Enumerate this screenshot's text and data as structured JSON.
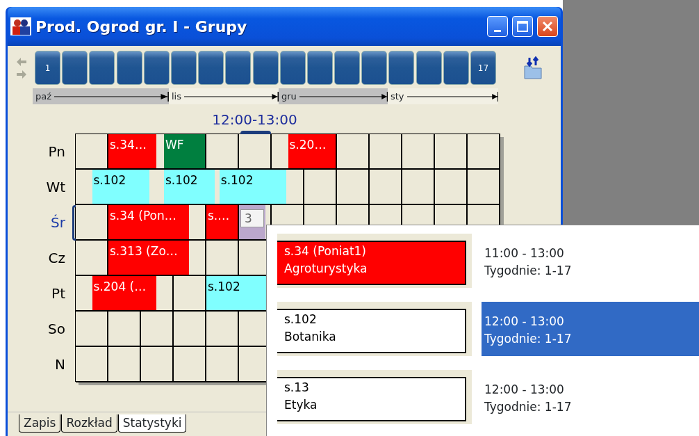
{
  "window": {
    "title": "Prod. Ogrod gr. I - Grupy"
  },
  "week_strip": {
    "first_label": "1",
    "last_label": "17"
  },
  "months": [
    {
      "label": "paź",
      "shaded": true
    },
    {
      "label": "lis",
      "shaded": false
    },
    {
      "label": "gru",
      "shaded": true
    },
    {
      "label": "sty",
      "shaded": false
    }
  ],
  "time_header": "12:00-13:00",
  "days": [
    {
      "label": "Pn",
      "selected": false,
      "events": [
        {
          "kind": "block",
          "text": "s.34…",
          "color": "#ff0000"
        },
        {
          "kind": "block",
          "text": "WF",
          "color": "#007f3f"
        },
        {
          "kind": "block",
          "text": "s.20…",
          "color": "#ff0000"
        }
      ]
    },
    {
      "label": "Wt",
      "selected": false,
      "events": [
        {
          "kind": "block",
          "text": "s.102",
          "color": "#80ffff"
        },
        {
          "kind": "block",
          "text": "s.102",
          "color": "#80ffff"
        },
        {
          "kind": "block",
          "text": "s.102",
          "color": "#80ffff"
        }
      ]
    },
    {
      "label": "Śr",
      "selected": true,
      "events": [
        {
          "kind": "block",
          "text": "s.34 (Pon…",
          "color": "#ff0000"
        },
        {
          "kind": "block",
          "text": "s.…",
          "color": "#ff0000"
        },
        {
          "kind": "spinner",
          "text": "3",
          "color": "#bba8cc"
        }
      ]
    },
    {
      "label": "Cz",
      "selected": false,
      "events": [
        {
          "kind": "block",
          "text": "s.313 (Zo…",
          "color": "#ff0000"
        }
      ]
    },
    {
      "label": "Pt",
      "selected": false,
      "events": [
        {
          "kind": "block",
          "text": "s.204 (…",
          "color": "#ff0000"
        },
        {
          "kind": "block",
          "text": "s.102",
          "color": "#80ffff"
        }
      ]
    },
    {
      "label": "So",
      "selected": false
    },
    {
      "label": "N",
      "selected": false
    }
  ],
  "popup": [
    {
      "room": "s.34 (Poniat1)",
      "subject": "Agroturystyka",
      "time": "11:00 - 13:00",
      "weeks": "Tygodnie: 1-17",
      "color": "#ff0000",
      "selected": false
    },
    {
      "room": "s.102",
      "subject": "Botanika",
      "time": "12:00 - 13:00",
      "weeks": "Tygodnie: 1-17",
      "color": "#ffffff",
      "selected": true
    },
    {
      "room": "s.13",
      "subject": "Etyka",
      "time": "12:00 - 13:00",
      "weeks": "Tygodnie: 1-17",
      "color": "#ffffff",
      "selected": false
    }
  ],
  "tabs": [
    {
      "label": "Zapis",
      "selected": false
    },
    {
      "label": "Rozkład",
      "selected": false
    },
    {
      "label": "Statystyki",
      "selected": true
    }
  ]
}
